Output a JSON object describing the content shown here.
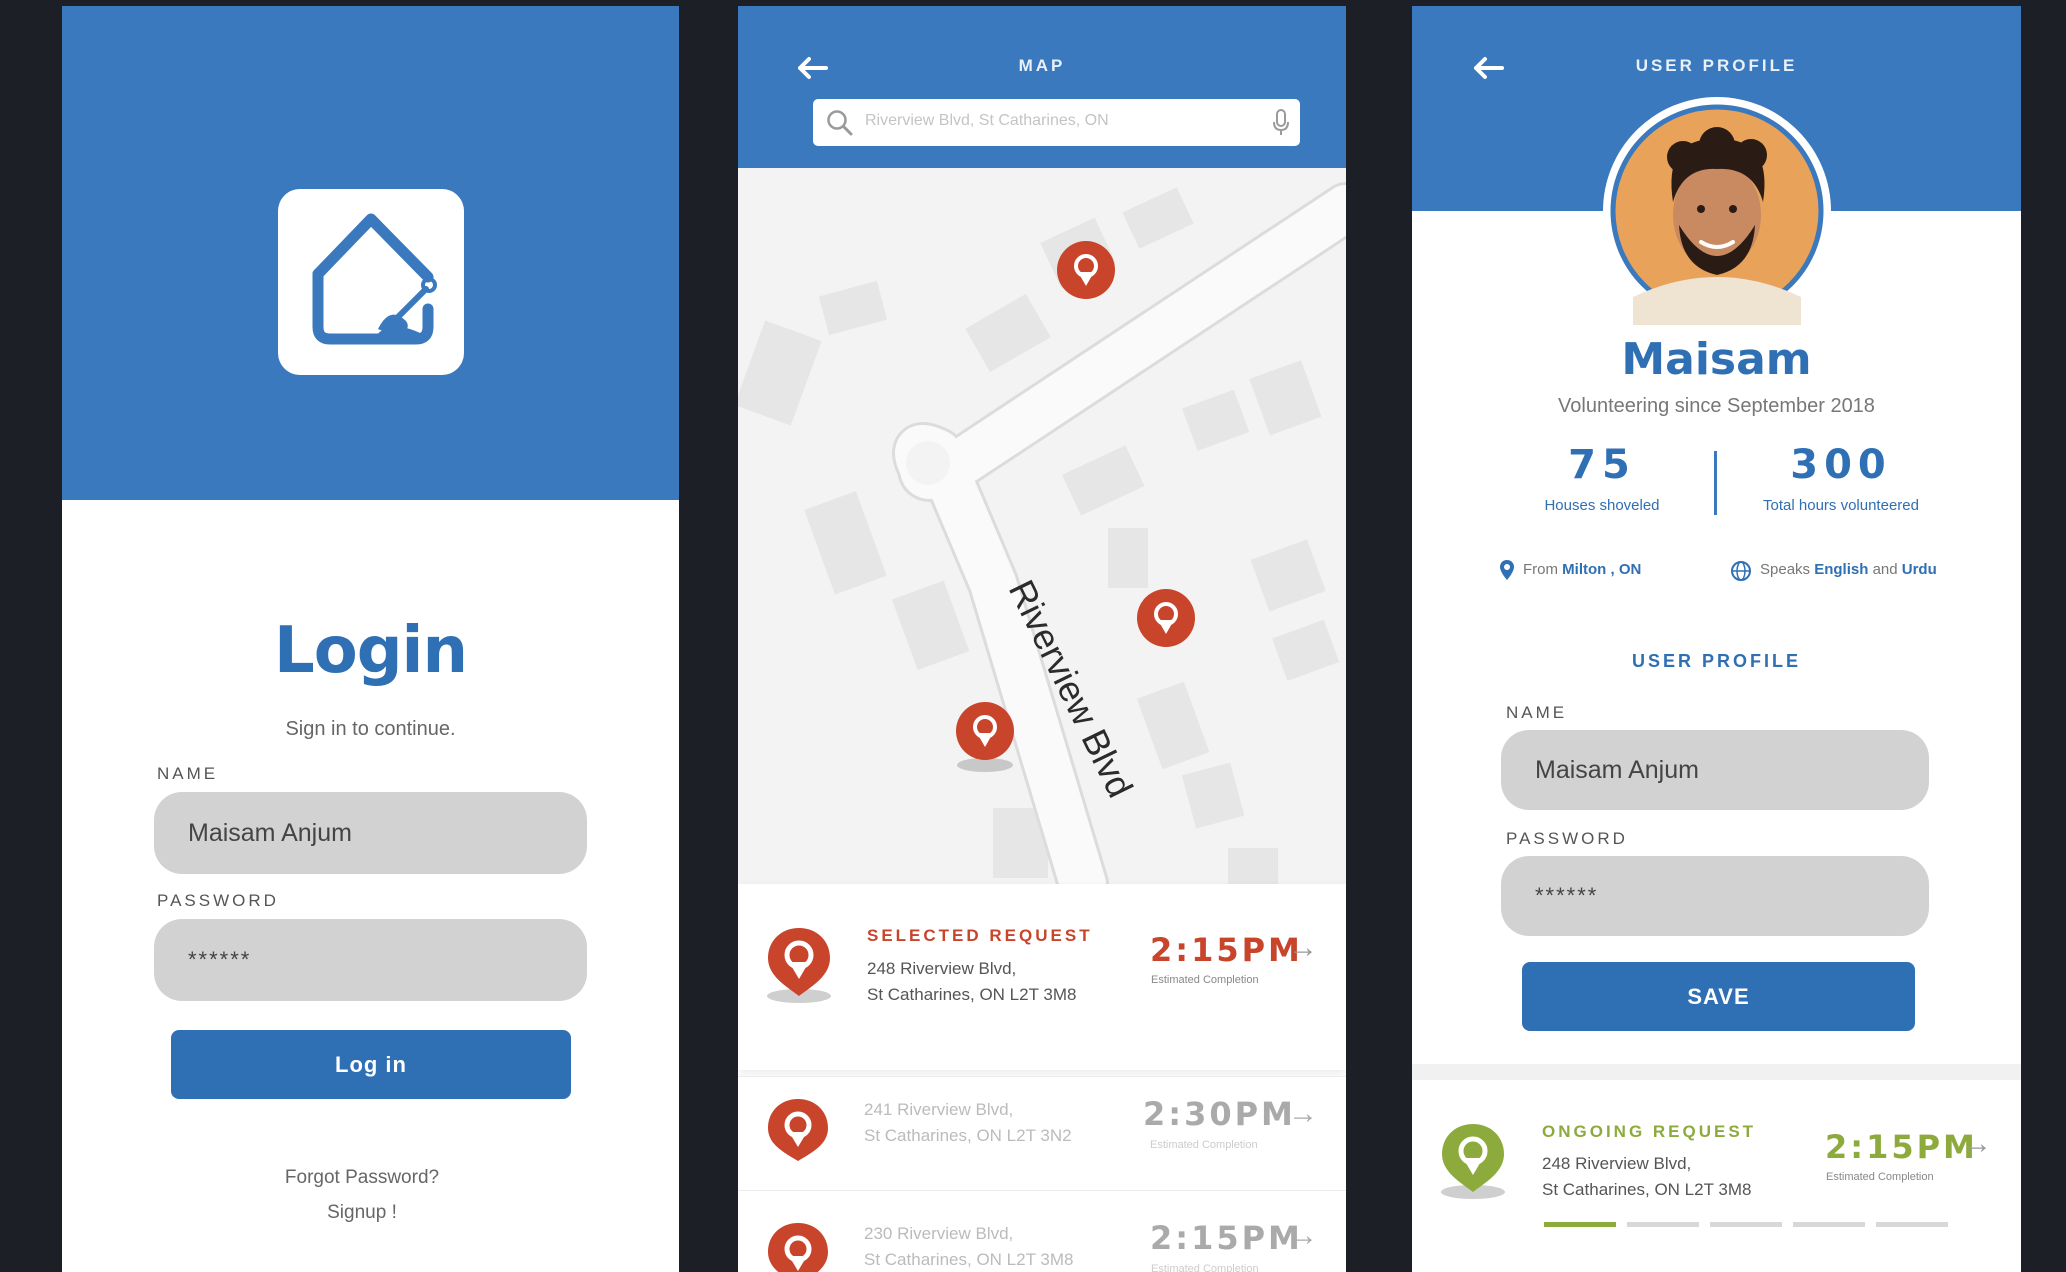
{
  "login": {
    "title": "Login",
    "subtitle": "Sign in to continue.",
    "name_label": "NAME",
    "name_value": "Maisam Anjum",
    "password_label": "PASSWORD",
    "password_value": "******",
    "login_button": "Log in",
    "forgot_link": "Forgot Password?",
    "signup_link": "Signup !"
  },
  "map": {
    "header_title": "MAP",
    "search_placeholder": "Riverview Blvd, St Catharines, ON",
    "street_label": "Riverview Blvd",
    "requests": [
      {
        "tag": "SELECTED REQUEST",
        "address_line1": "248 Riverview Blvd,",
        "address_line2": "St Catharines, ON L2T 3M8",
        "time": "2:15PM",
        "time_caption": "Estimated Completion"
      },
      {
        "tag": "",
        "address_line1": "241 Riverview Blvd,",
        "address_line2": "St Catharines, ON L2T 3N2",
        "time": "2:30PM",
        "time_caption": "Estimated Completion"
      },
      {
        "tag": "",
        "address_line1": "230 Riverview Blvd,",
        "address_line2": "St Catharines, ON L2T 3M8",
        "time": "2:15PM",
        "time_caption": "Estimated Completion"
      }
    ]
  },
  "profile": {
    "header_title": "USER PROFILE",
    "name": "Maisam",
    "since": "Volunteering since September 2018",
    "stats": [
      {
        "value": "75",
        "label": "Houses shoveled"
      },
      {
        "value": "300",
        "label": "Total hours volunteered"
      }
    ],
    "from_prefix": "From",
    "from_value": "Milton , ON",
    "speaks_prefix": "Speaks",
    "lang1": "English",
    "and_word": "and",
    "lang2": "Urdu",
    "section_title": "USER PROFILE",
    "name_label": "NAME",
    "name_value": "Maisam Anjum",
    "password_label": "PASSWORD",
    "password_value": "******",
    "save_button": "SAVE",
    "ongoing": {
      "tag": "ONGOING REQUEST",
      "address_line1": "248 Riverview Blvd,",
      "address_line2": "St Catharines, ON L2T 3M8",
      "time": "2:15PM",
      "time_caption": "Estimated Completion",
      "progress_steps_total": 5,
      "progress_steps_done": 1
    }
  },
  "colors": {
    "brand_blue": "#3a79bd",
    "pin_red": "#c8442b",
    "ongoing_green": "#8cab3c",
    "background": "#1c1f26"
  }
}
